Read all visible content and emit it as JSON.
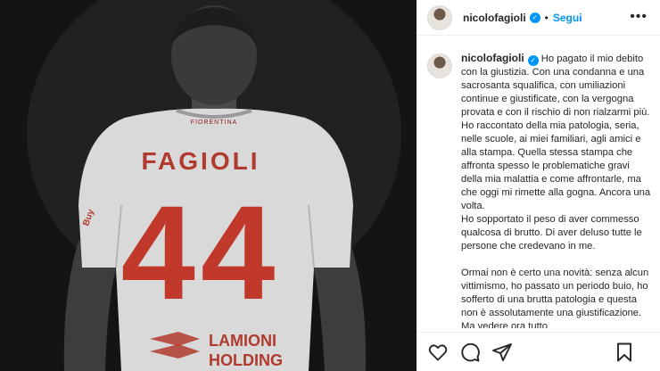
{
  "post": {
    "username": "nicolofagioli",
    "follow_label": "Segui",
    "separator": "•",
    "more_label": "•••",
    "verified_mark": "✓"
  },
  "photo": {
    "jersey_club": "FIORENTINA",
    "jersey_name": "FAGIOLI",
    "jersey_number": "44",
    "sponsor_line1": "LAMIONI",
    "sponsor_line2": "HOLDING",
    "sleeve_text": "Buy",
    "colors": {
      "jersey": "#d9d9d9",
      "number": "#c0392b",
      "background": "#151515"
    }
  },
  "caption": {
    "paragraph1": "Ho pagato il mio debito con la giustizia. Con una condanna e una sacrosanta squalifica, con umiliazioni continue e giustificate, con la vergogna provata e con il rischio di non rialzarmi più. Ho raccontato della mia patologia, seria, nelle scuole, ai miei familiari, agli amici e alla stampa. Quella stessa stampa che affronta spesso le problematiche gravi della mia malattia e come affrontarle, ma che oggi mi rimette alla gogna. Ancora una volta.",
    "paragraph2": "Ho sopportato il peso di aver commesso qualcosa di brutto. Di aver deluso tutte le persone che credevano in me.",
    "paragraph3": "Ormai non è certo una novità: senza alcun vittimismo, ho passato un periodo buio, ho sofferto di una brutta patologia e questa non è assolutamente una giustificazione. Ma vedere ora tutto"
  },
  "actions": {
    "icons": [
      "heart-icon",
      "comment-icon",
      "share-icon",
      "bookmark-icon"
    ]
  }
}
